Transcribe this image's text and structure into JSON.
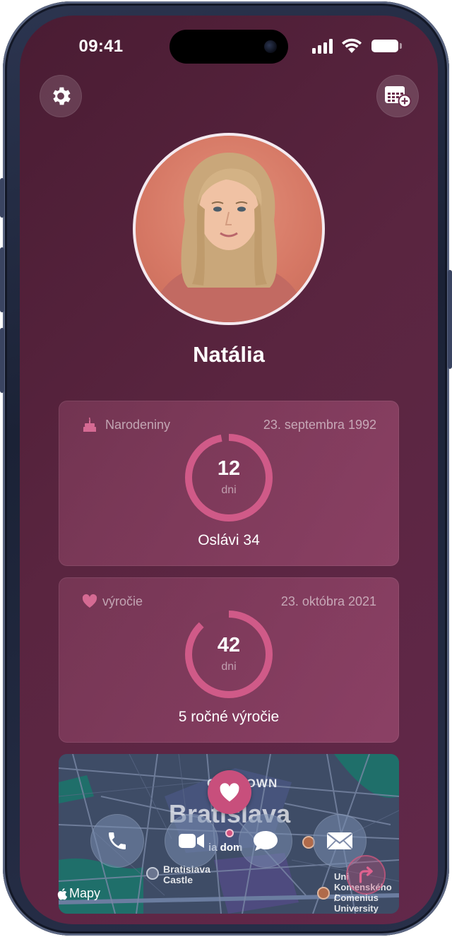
{
  "status_bar": {
    "time": "09:41"
  },
  "profile": {
    "name": "Natália"
  },
  "cards": [
    {
      "icon": "birthday-cake-icon",
      "label": "Narodeniny",
      "date": "23. septembra 1992",
      "days": "12",
      "unit": "dni",
      "caption": "Oslávi 34",
      "progress": 0.97
    },
    {
      "icon": "heart-icon",
      "label": "výročie",
      "date": "23. októbra 2021",
      "days": "42",
      "unit": "dni",
      "caption": "5 ročné výročie",
      "progress": 0.88
    }
  ],
  "map": {
    "district_label": "OLD TOWN",
    "city_label": "Bratislava",
    "poi_castle": "Bratislava\nCastle",
    "poi_castle_line1": "Bratislava",
    "poi_castle_line2": "Castle",
    "poi_partial": "ia dom",
    "poi_university_line1": "Uni",
    "poi_university_line2": "Komenského /",
    "poi_university_line3": "Comenius",
    "poi_university_line4": "University",
    "attribution": "Mapy"
  },
  "actions": {
    "call": "phone-icon",
    "video": "video-camera-icon",
    "message": "message-bubble-icon",
    "mail": "envelope-icon"
  },
  "colors": {
    "background": "#5a2540",
    "accent": "#d05a88",
    "ring_track": "#7d3a5a"
  }
}
